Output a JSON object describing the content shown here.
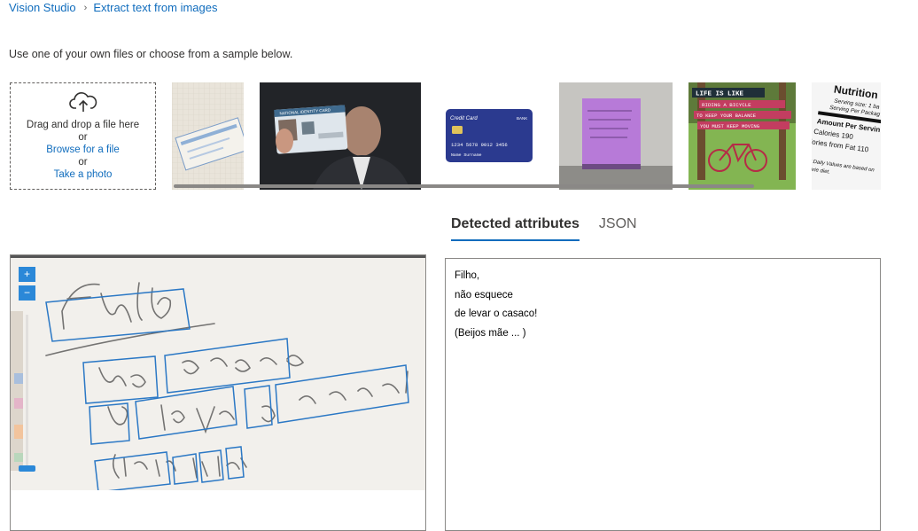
{
  "breadcrumb": {
    "root": "Vision Studio",
    "current": "Extract text from images"
  },
  "intro": "Use one of your own files or choose from a sample below.",
  "dropzone": {
    "drag_text": "Drag and drop a file here",
    "or1": "or",
    "browse": "Browse for a file",
    "or2": "or",
    "photo": "Take a photo"
  },
  "samples": {
    "card": {
      "brand": "Credit Card",
      "bank": "BANK",
      "number": "1234 5678 9012 3456",
      "name": "Name Surname"
    },
    "idcard": {
      "title": "NATIONAL IDENTITY CARD"
    },
    "poster": {
      "line1": "LIFE IS LIKE",
      "line2": "RIDING A BICYCLE",
      "line3": "TO KEEP YOUR BALANCE",
      "line4": "YOU MUST KEEP MOVING"
    },
    "nutrition": {
      "title": "Nutrition",
      "l1": "Serving size: 1 ba",
      "l2": "Serving Per Packag",
      "l3": "Amount Per Servin",
      "l4": "Calories 190",
      "l5": "lories from Fat 110",
      "l6": "ent Daily Values are based on",
      "l7": "calorie diet."
    }
  },
  "tabs": {
    "attributes": "Detected attributes",
    "json": "JSON"
  },
  "preview": {
    "zoom_in": "+",
    "zoom_out": "−"
  },
  "results": {
    "lines": [
      "Filho,",
      "não esquece",
      "de levar o casaco!",
      "(Beijos mãe ... )"
    ]
  },
  "colors": {
    "accent": "#0f6cbd",
    "box": "#2b78c5"
  }
}
